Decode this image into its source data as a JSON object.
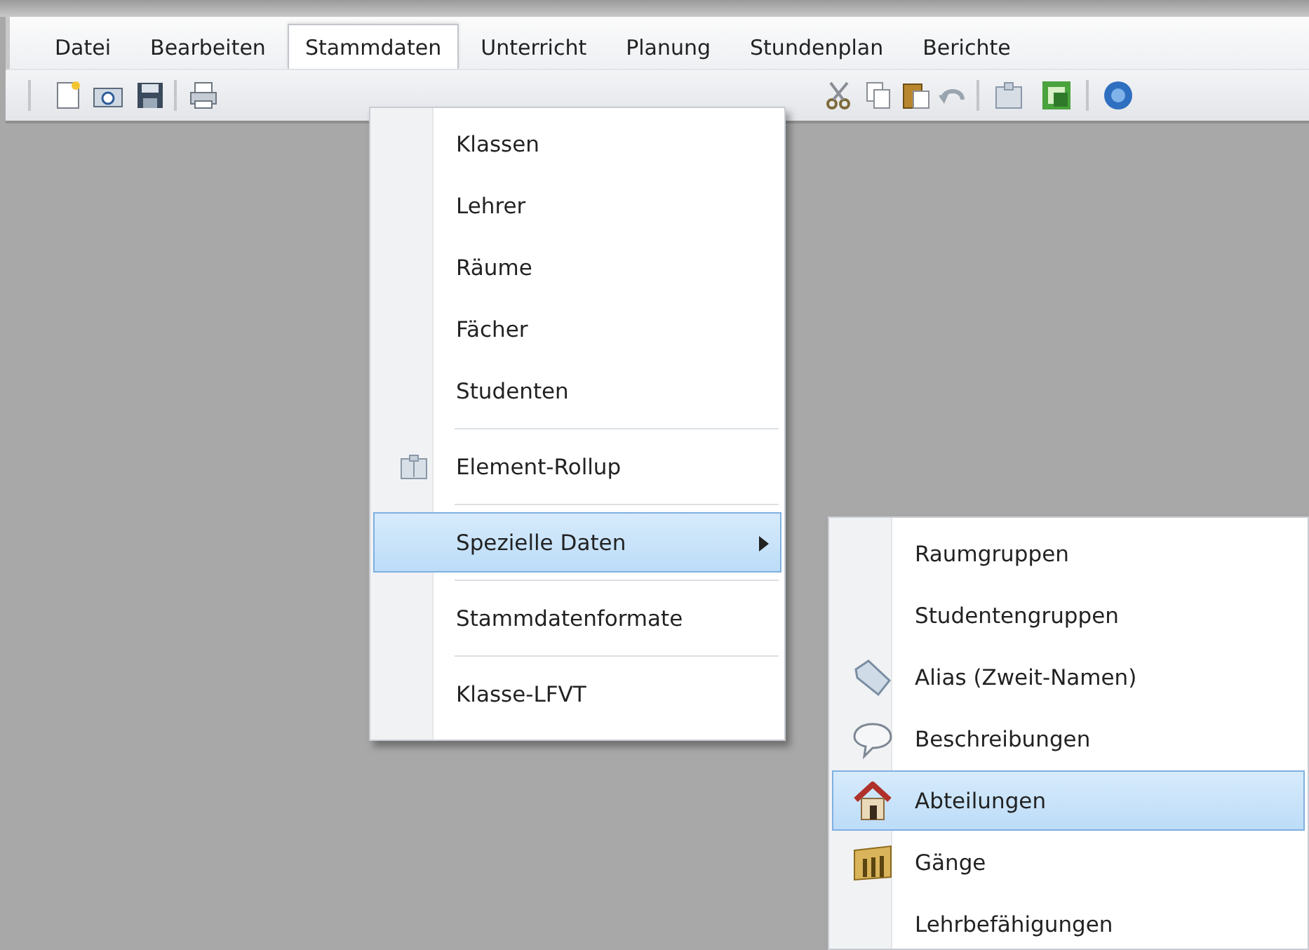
{
  "menubar": [
    {
      "label": "Datei",
      "selected": false
    },
    {
      "label": "Bearbeiten",
      "selected": false
    },
    {
      "label": "Stammdaten",
      "selected": true
    },
    {
      "label": "Unterricht",
      "selected": false
    },
    {
      "label": "Planung",
      "selected": false
    },
    {
      "label": "Stundenplan",
      "selected": false
    },
    {
      "label": "Berichte",
      "selected": false
    }
  ],
  "menu": [
    {
      "kind": "item",
      "label": "Klassen",
      "selected": false
    },
    {
      "kind": "item",
      "label": "Lehrer",
      "selected": false
    },
    {
      "kind": "item",
      "label": "Räume",
      "selected": false
    },
    {
      "kind": "item",
      "label": "Fächer",
      "selected": false
    },
    {
      "kind": "item",
      "label": "Studenten",
      "selected": false
    },
    {
      "kind": "separator"
    },
    {
      "kind": "item",
      "label": "Element-Rollup",
      "selected": false
    },
    {
      "kind": "separator"
    },
    {
      "kind": "item",
      "label": "Spezielle Daten",
      "selected": true,
      "has_submenu": true
    },
    {
      "kind": "separator"
    },
    {
      "kind": "item",
      "label": "Stammdatenformate",
      "selected": false
    },
    {
      "kind": "separator"
    },
    {
      "kind": "item",
      "label": "Klasse-LFVT",
      "selected": false
    }
  ],
  "submenu": [
    {
      "kind": "item",
      "label": "Raumgruppen",
      "selected": false
    },
    {
      "kind": "item",
      "label": "Studentengruppen",
      "selected": false
    },
    {
      "kind": "item",
      "label": "Alias (Zweit-Namen)",
      "selected": false
    },
    {
      "kind": "item",
      "label": "Beschreibungen",
      "selected": false
    },
    {
      "kind": "item",
      "label": "Abteilungen",
      "selected": true
    },
    {
      "kind": "item",
      "label": "Gänge",
      "selected": false
    },
    {
      "kind": "item",
      "label": "Lehrbefähigungen",
      "selected": false
    }
  ]
}
